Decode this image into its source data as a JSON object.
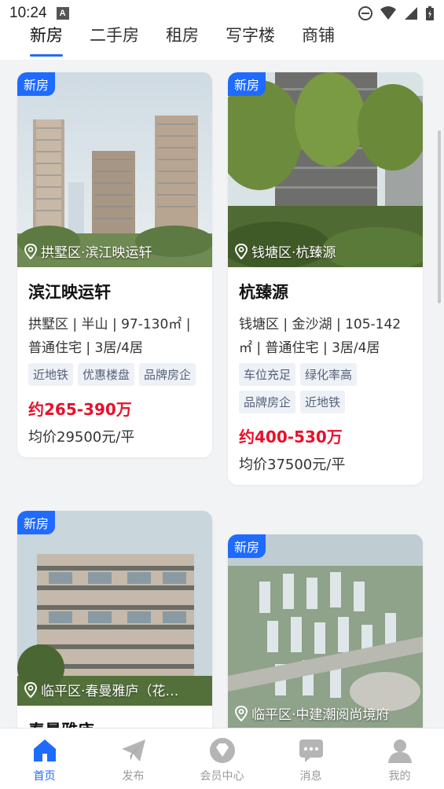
{
  "status": {
    "time": "10:24",
    "a_label": "A"
  },
  "tabs": [
    {
      "label": "新房",
      "active": true
    },
    {
      "label": "二手房"
    },
    {
      "label": "租房"
    },
    {
      "label": "写字楼"
    },
    {
      "label": "商铺"
    }
  ],
  "cards": [
    {
      "badge": "新房",
      "location": "拱墅区·滨江映运轩",
      "title": "滨江映运轩",
      "desc": "拱墅区 | 半山 | 97-130㎡ | 普通住宅 | 3居/4居",
      "tags": [
        "近地铁",
        "优惠楼盘",
        "品牌房企"
      ],
      "price": "约265-390万",
      "avg": "均价29500元/平"
    },
    {
      "badge": "新房",
      "location": "钱塘区·杭臻源",
      "title": "杭臻源",
      "desc": "钱塘区 | 金沙湖 | 105-142㎡ | 普通住宅 | 3居/4居",
      "tags": [
        "车位充足",
        "绿化率高",
        "品牌房企",
        "近地铁"
      ],
      "price": "约400-530万",
      "avg": "均价37500元/平"
    },
    {
      "badge": "新房",
      "location": "临平区·春曼雅庐（花…",
      "title": "春曼雅庐"
    },
    {
      "badge": "新房",
      "location": "临平区·中建潮阅尚境府"
    }
  ],
  "nav": [
    {
      "label": "首页",
      "icon": "home-icon",
      "active": true
    },
    {
      "label": "发布",
      "icon": "paper-plane-icon"
    },
    {
      "label": "会员中心",
      "icon": "diamond-icon"
    },
    {
      "label": "消息",
      "icon": "message-icon"
    },
    {
      "label": "我的",
      "icon": "user-icon"
    }
  ],
  "colors": {
    "accent": "#1f6bff",
    "price": "#e8102a",
    "tag_bg": "#eef1f6"
  }
}
